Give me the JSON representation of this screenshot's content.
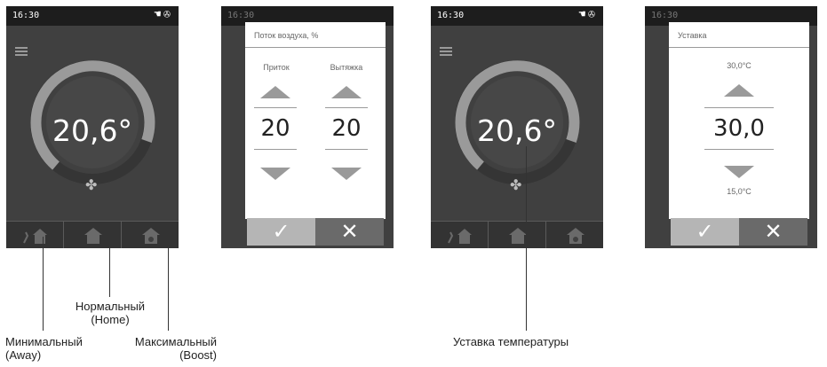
{
  "status": {
    "time": "16:30"
  },
  "screen1": {
    "temperature": "20,6°"
  },
  "screen2": {
    "title": "Поток воздуха, %",
    "col1_label": "Приток",
    "col2_label": "Вытяжка",
    "col1_value": "20",
    "col2_value": "20",
    "ok_label": "✓",
    "cancel_label": "✕"
  },
  "screen3": {
    "temperature": "20,6°"
  },
  "screen4": {
    "title": "Уставка",
    "max_label": "30,0°C",
    "value": "30,0",
    "min_label": "15,0°C",
    "ok_label": "✓",
    "cancel_label": "✕"
  },
  "annotations": {
    "home": "Нормальный\n(Home)",
    "away": "Минимальный\n(Away)",
    "boost": "Максимальный\n(Boost)",
    "setpoint": "Уставка температуры"
  },
  "colors": {
    "screen_bg": "#404040",
    "statusbar": "#1d1d1d",
    "ring": "#9a9a9a",
    "dial": "#474747"
  }
}
